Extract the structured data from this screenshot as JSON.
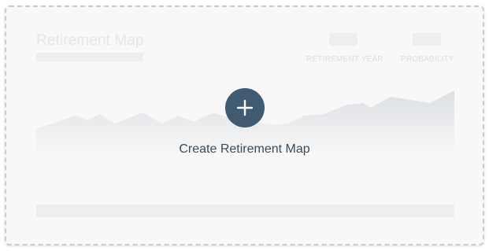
{
  "card": {
    "title": "Retirement Map",
    "stats": [
      {
        "label": "RETIREMENT YEAR"
      },
      {
        "label": "PROBABILITY"
      }
    ],
    "create": {
      "label": "Create Retirement Map",
      "icon": "plus-icon"
    }
  },
  "colors": {
    "accent": "#3f5a71",
    "label_text": "#3a4b5b",
    "placeholder": "#eceef0",
    "chart_fill": "#dfe2e6",
    "card_bg": "#f8f8f8",
    "border": "#c9ccd0"
  }
}
